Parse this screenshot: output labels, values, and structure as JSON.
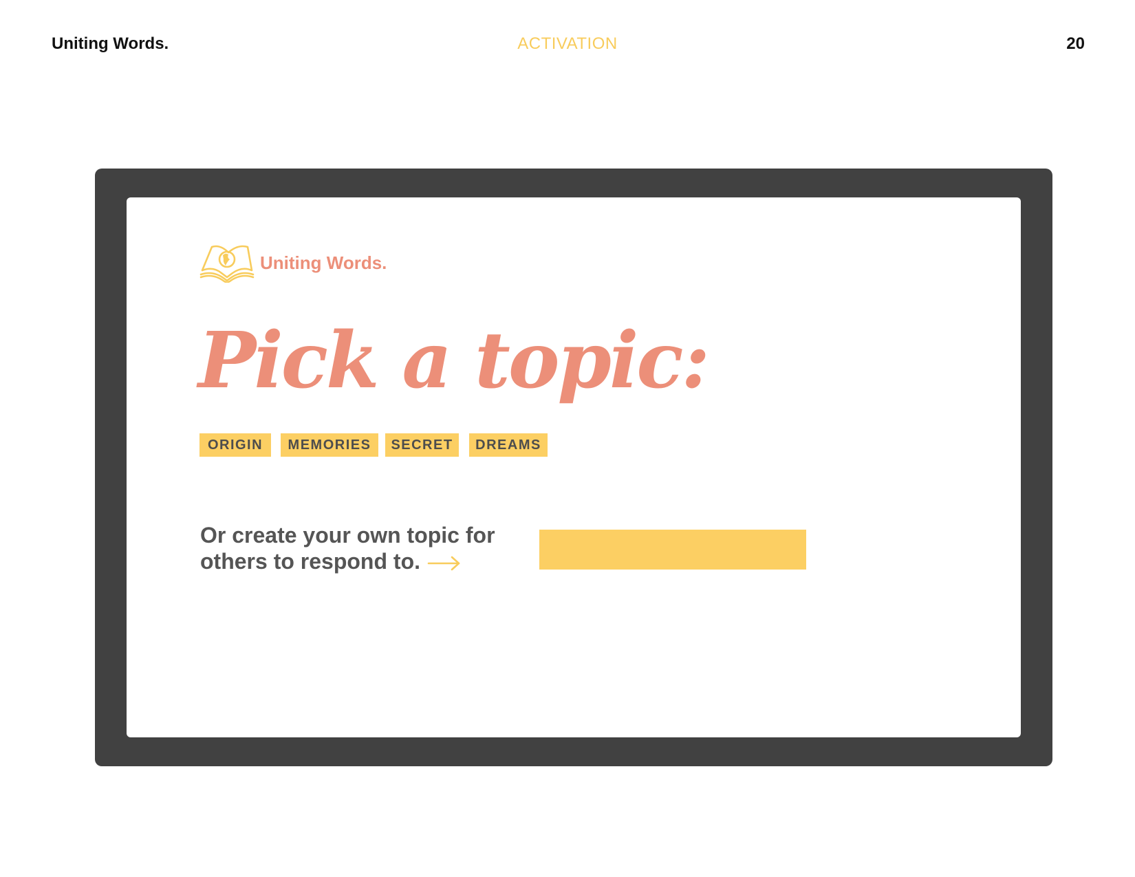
{
  "header": {
    "brand": "Uniting Words.",
    "section": "ACTIVATION",
    "page_number": "20"
  },
  "app": {
    "logo_text": "Uniting Words.",
    "logo_icon": "open-book-globe-icon",
    "title": "Pick a topic:",
    "topics": [
      "ORIGIN",
      "MEMORIES",
      "SECRET",
      "DREAMS"
    ],
    "prompt_line1": "Or create your own topic for",
    "prompt_line2": "others to respond to.",
    "input_value": "",
    "input_placeholder": ""
  },
  "colors": {
    "accent_yellow": "#fccf63",
    "accent_salmon": "#ec8f79",
    "frame_dark": "#414141",
    "text_gray": "#555555"
  }
}
